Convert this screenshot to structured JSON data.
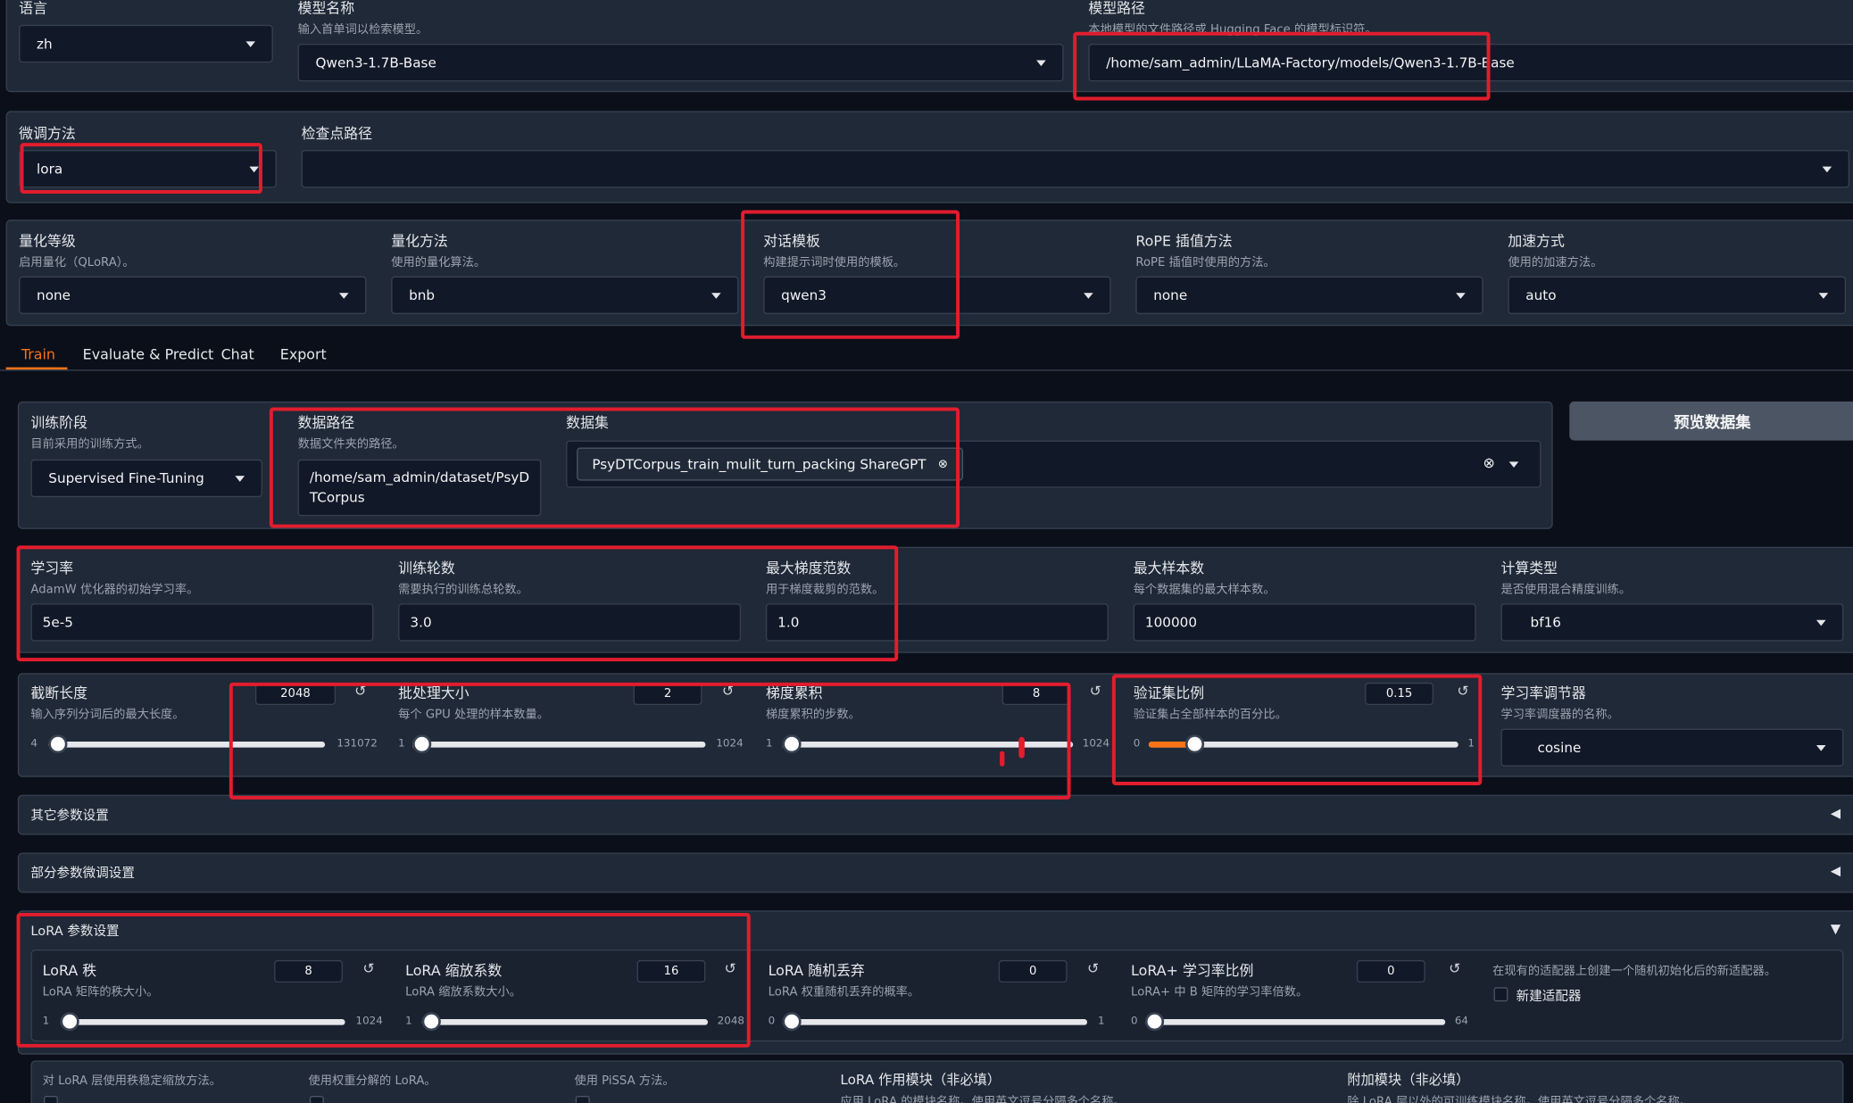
{
  "top": {
    "language_label": "语言",
    "language_value": "zh",
    "model_name_label": "模型名称",
    "model_name_info": "输入首单词以检索模型。",
    "model_name_value": "Qwen3-1.7B-Base",
    "model_path_label": "模型路径",
    "model_path_info": "本地模型的文件路径或 Hugging Face 的模型标识符。",
    "model_path_value": "/home/sam_admin/LLaMA-Factory/models/Qwen3-1.7B-Base"
  },
  "finetune": {
    "method_label": "微调方法",
    "method_value": "lora",
    "ckpt_label": "检查点路径"
  },
  "quant": {
    "bit_label": "量化等级",
    "bit_info": "启用量化（QLoRA）。",
    "bit_value": "none",
    "method_label": "量化方法",
    "method_info": "使用的量化算法。",
    "method_value": "bnb",
    "template_label": "对话模板",
    "template_info": "构建提示词时使用的模板。",
    "template_value": "qwen3",
    "rope_label": "RoPE 插值方法",
    "rope_info": "RoPE 插值时使用的方法。",
    "rope_value": "none",
    "booster_label": "加速方式",
    "booster_info": "使用的加速方法。",
    "booster_value": "auto"
  },
  "tabs": [
    "Train",
    "Evaluate & Predict",
    "Chat",
    "Export"
  ],
  "train": {
    "stage_label": "训练阶段",
    "stage_info": "目前采用的训练方式。",
    "stage_value": "Supervised Fine-Tuning",
    "dataset_dir_label": "数据路径",
    "dataset_dir_info": "数据文件夹的路径。",
    "dataset_dir_value": "/home/sam_admin/dataset/PsyDTCorpus",
    "dataset_label": "数据集",
    "dataset_chip": "PsyDTCorpus_train_mulit_turn_packing ShareGPT",
    "preview_button": "预览数据集"
  },
  "row1": {
    "lr_label": "学习率",
    "lr_info": "AdamW 优化器的初始学习率。",
    "lr_value": "5e-5",
    "epochs_label": "训练轮数",
    "epochs_info": "需要执行的训练总轮数。",
    "epochs_value": "3.0",
    "grad_label": "最大梯度范数",
    "grad_info": "用于梯度裁剪的范数。",
    "grad_value": "1.0",
    "samples_label": "最大样本数",
    "samples_info": "每个数据集的最大样本数。",
    "samples_value": "100000",
    "compute_label": "计算类型",
    "compute_info": "是否使用混合精度训练。",
    "compute_value": "bf16"
  },
  "row2": {
    "cutoff_label": "截断长度",
    "cutoff_info": "输入序列分词后的最大长度。",
    "cutoff_value": "2048",
    "cutoff_min": "4",
    "cutoff_max": "131072",
    "cutoff_level": 0.016,
    "batch_label": "批处理大小",
    "batch_info": "每个 GPU 处理的样本数量。",
    "batch_value": "2",
    "batch_min": "1",
    "batch_max": "1024",
    "batch_level": 0.001,
    "gas_label": "梯度累积",
    "gas_info": "梯度累积的步数。",
    "gas_value": "8",
    "gas_min": "1",
    "gas_max": "1024",
    "gas_level": 0.007,
    "val_label": "验证集比例",
    "val_info": "验证集占全部样本的百分比。",
    "val_value": "0.15",
    "val_min": "0",
    "val_max": "1",
    "val_level": 0.15,
    "sched_label": "学习率调节器",
    "sched_info": "学习率调度器的名称。",
    "sched_value": "cosine"
  },
  "accordions": {
    "other": "其它参数设置",
    "freeze": "部分参数微调设置",
    "lora": "LoRA 参数设置"
  },
  "lora": {
    "rank_label": "LoRA 秩",
    "rank_info": "LoRA 矩阵的秩大小。",
    "rank_value": "8",
    "rank_min": "1",
    "rank_max": "1024",
    "alpha_label": "LoRA 缩放系数",
    "alpha_info": "LoRA 缩放系数大小。",
    "alpha_value": "16",
    "alpha_min": "1",
    "alpha_max": "2048",
    "dropout_label": "LoRA 随机丢弃",
    "dropout_info": "LoRA 权重随机丢弃的概率。",
    "dropout_value": "0",
    "dropout_min": "0",
    "dropout_max": "1",
    "plus_label": "LoRA+ 学习率比例",
    "plus_info": "LoRA+ 中 B 矩阵的学习率倍数。",
    "plus_value": "0",
    "plus_min": "0",
    "plus_max": "64",
    "new_adapter_info": "在现有的适配器上创建一个随机初始化后的新适配器。",
    "new_adapter_label": "新建适配器"
  },
  "bottom": {
    "rslora_info": "对 LoRA 层使用秩稳定缩放方法。",
    "dora_info": "使用权重分解的 LoRA。",
    "pissa_info": "使用 PiSSA 方法。",
    "target_label": "LoRA 作用模块（非必填）",
    "target_info": "应用 LoRA 的模块名称。使用英文逗号分隔多个名称。",
    "extra_label": "附加模块（非必填）",
    "extra_info": "除 LoRA 层以外的可训练模块名称。使用英文逗号分隔多个名称。"
  },
  "colors": {
    "accent": "#f97316",
    "highlight": "#e11d2e",
    "background": "#0b0f19",
    "block": "#1f2937"
  }
}
